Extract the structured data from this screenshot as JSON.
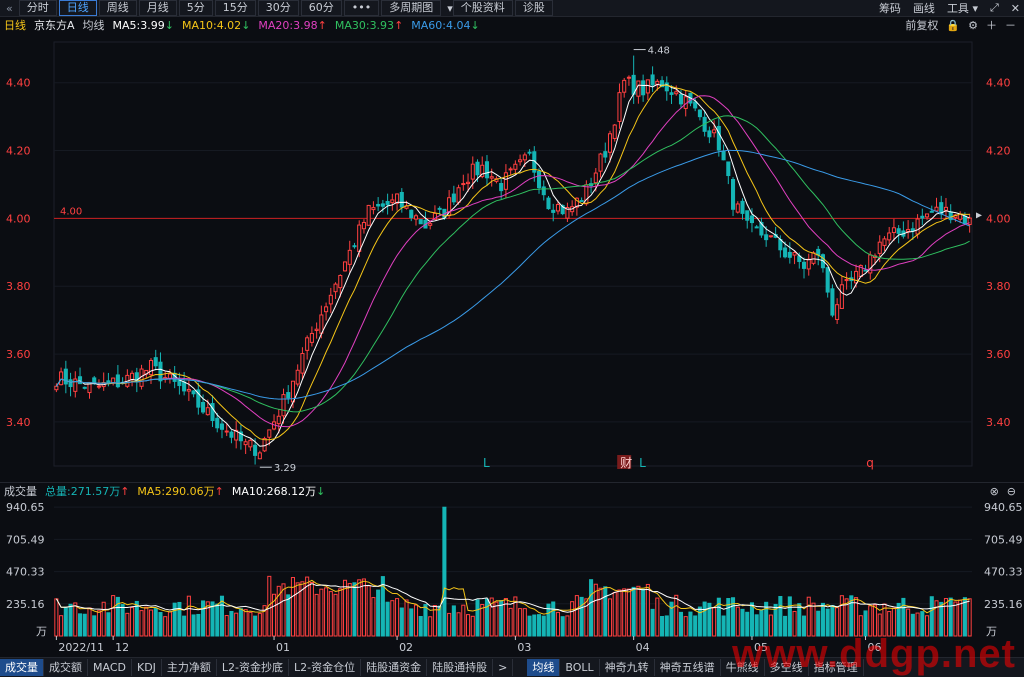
{
  "toolbar": {
    "back_icon": "«",
    "tabs": [
      "分时",
      "日线",
      "周线",
      "月线",
      "5分",
      "15分",
      "30分",
      "60分",
      "•••",
      "多周期图",
      "个股资料",
      "诊股"
    ],
    "active_tab": "日线",
    "dropdown_icon": "▾",
    "right": [
      "筹码",
      "画线",
      "工具"
    ],
    "window_controls": [
      "▾",
      "⤢",
      "✕"
    ]
  },
  "info": {
    "period": "日线",
    "stock_name": "京东方A",
    "ma_label": "均线",
    "ma5": "MA5:3.99",
    "ma10": "MA10:4.02",
    "ma20": "MA20:3.98",
    "ma30": "MA30:3.93",
    "ma60": "MA60:4.04",
    "restore": "前复权",
    "arrows": {
      "ma5": "↓",
      "ma10": "↓",
      "ma20": "↑",
      "ma30": "↑",
      "ma60": "↓"
    }
  },
  "volume_bar": {
    "title": "成交量",
    "total": "总量:271.57万",
    "ma5": "MA5:290.06万",
    "ma10": "MA10:268.12万",
    "arrows": {
      "total": "↑",
      "ma5": "↑",
      "ma10": "↓"
    }
  },
  "bottom_tabs": [
    "成交量",
    "成交额",
    "MACD",
    "KDJ",
    "主力净额",
    "L2-资金抄底",
    "L2-资金仓位",
    "陆股通资金",
    "陆股通持股",
    ">",
    "均线",
    "BOLL",
    "神奇九转",
    "神奇五线谱",
    "牛熊线",
    "多空线",
    "指标管理"
  ],
  "watermark": "www.ddgp.net",
  "colors": {
    "up": "#ff4040",
    "down": "#15b5b5",
    "ma5": "#ffffff",
    "ma10": "#f5c518",
    "ma20": "#e040c0",
    "ma30": "#30c060",
    "ma60": "#3a9be8",
    "axis_text": "#ff4040",
    "refline": "#cc2020"
  },
  "chart_data": [
    {
      "type": "candlestick",
      "ylim": [
        3.27,
        4.52
      ],
      "y_ticks": [
        "4.40",
        "4.20",
        "4.00",
        "3.80",
        "3.60",
        "3.40"
      ],
      "reference_line": {
        "value": 4.0,
        "label": "4.00"
      },
      "x_labels": [
        "2022/11",
        "12",
        "01",
        "02",
        "03",
        "04",
        "05",
        "06"
      ],
      "x_label_index": [
        0,
        12,
        46,
        72,
        97,
        122,
        147,
        171
      ],
      "annotations": [
        {
          "text": "4.48",
          "index": 122,
          "value": 4.48
        },
        {
          "text": "3.29",
          "index": 43,
          "value": 3.29
        }
      ],
      "markers": [
        {
          "text": "L",
          "index": 91
        },
        {
          "text": "财",
          "index": 120
        },
        {
          "text": "L",
          "index": 124
        },
        {
          "text": "q",
          "index": 172
        }
      ],
      "keypoints": [
        [
          0,
          3.53
        ],
        [
          8,
          3.5
        ],
        [
          14,
          3.52
        ],
        [
          20,
          3.56
        ],
        [
          26,
          3.5
        ],
        [
          30,
          3.45
        ],
        [
          34,
          3.4
        ],
        [
          40,
          3.33
        ],
        [
          43,
          3.32
        ],
        [
          48,
          3.46
        ],
        [
          54,
          3.66
        ],
        [
          60,
          3.84
        ],
        [
          66,
          4.02
        ],
        [
          72,
          4.05
        ],
        [
          78,
          3.98
        ],
        [
          82,
          4.02
        ],
        [
          86,
          4.12
        ],
        [
          90,
          4.15
        ],
        [
          94,
          4.1
        ],
        [
          100,
          4.18
        ],
        [
          104,
          4.05
        ],
        [
          108,
          4.02
        ],
        [
          112,
          4.08
        ],
        [
          116,
          4.2
        ],
        [
          120,
          4.4
        ],
        [
          124,
          4.38
        ],
        [
          128,
          4.4
        ],
        [
          132,
          4.36
        ],
        [
          136,
          4.3
        ],
        [
          140,
          4.22
        ],
        [
          143,
          4.05
        ],
        [
          146,
          3.97
        ],
        [
          150,
          3.95
        ],
        [
          154,
          3.9
        ],
        [
          158,
          3.86
        ],
        [
          161,
          3.9
        ],
        [
          164,
          3.73
        ],
        [
          166,
          3.78
        ],
        [
          170,
          3.84
        ],
        [
          174,
          3.93
        ],
        [
          180,
          3.97
        ],
        [
          185,
          4.02
        ],
        [
          190,
          4.02
        ],
        [
          193,
          3.99
        ]
      ],
      "candle_count": 194,
      "series": [
        {
          "name": "MA5",
          "value": 3.99
        },
        {
          "name": "MA10",
          "value": 4.02
        },
        {
          "name": "MA20",
          "value": 3.98
        },
        {
          "name": "MA30",
          "value": 3.93
        },
        {
          "name": "MA60",
          "value": 4.04
        }
      ]
    },
    {
      "type": "bar",
      "title": "成交量",
      "ylim": [
        0,
        1000
      ],
      "y_ticks": [
        "940.65",
        "705.49",
        "470.33",
        "235.16"
      ],
      "unit": "万",
      "series": [
        {
          "name": "总量",
          "last": 271.57
        },
        {
          "name": "MA5",
          "last": 290.06
        },
        {
          "name": "MA10",
          "last": 268.12
        }
      ]
    }
  ]
}
